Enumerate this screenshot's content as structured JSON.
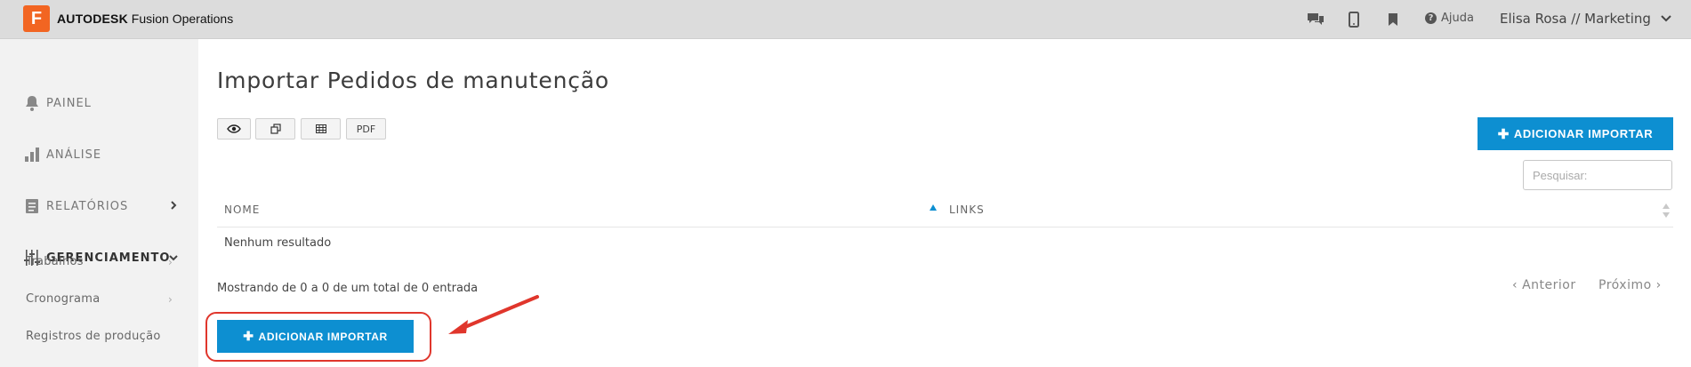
{
  "brand": {
    "logo_letter": "F",
    "company": "AUTODESK",
    "product": "Fusion Operations",
    "logo_color": "#f26522"
  },
  "topbar": {
    "help_label": "Ajuda",
    "user_label": "Elisa Rosa // Marketing",
    "icons": [
      "chat-icon",
      "mobile-icon",
      "bookmark-icon",
      "help-icon",
      "chevron-down-icon"
    ]
  },
  "sidebar": {
    "items": [
      {
        "label": "PAINEL",
        "icon": "bell-icon"
      },
      {
        "label": "ANÁLISE",
        "icon": "bar-chart-icon"
      },
      {
        "label": "RELATÓRIOS",
        "icon": "report-icon"
      },
      {
        "label": "GERENCIAMENTO",
        "icon": "sliders-icon"
      }
    ],
    "subitems": [
      {
        "label": "Trabalhos"
      },
      {
        "label": "Cronograma"
      },
      {
        "label": "Registros de produção"
      }
    ]
  },
  "main": {
    "title": "Importar Pedidos de manutenção",
    "toolbar": {
      "pdf_label": "PDF"
    },
    "add_button_label": "ADICIONAR IMPORTAR",
    "search_placeholder": "Pesquisar:",
    "table": {
      "columns": [
        "NOME",
        "LINKS"
      ],
      "empty_text": "Nenhum resultado"
    },
    "info_text": "Mostrando de 0 a 0 de um total de 0 entrada",
    "pager": {
      "prev_label": "Anterior",
      "next_label": "Próximo"
    }
  },
  "colors": {
    "accent": "#0d8fd1",
    "annotation": "#e0362c",
    "sidebar_bg": "#f2f2f2",
    "topbar_bg": "#dcdcdc"
  }
}
